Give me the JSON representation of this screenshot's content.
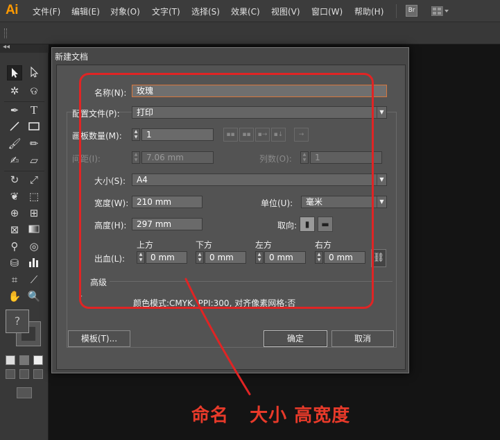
{
  "app": {
    "logo": "Ai"
  },
  "menu": [
    "文件(F)",
    "编辑(E)",
    "对象(O)",
    "文字(T)",
    "选择(S)",
    "效果(C)",
    "视图(V)",
    "窗口(W)",
    "帮助(H)"
  ],
  "menubar_extras": {
    "bridge_label": "Br"
  },
  "toolbar": {
    "tools": [
      "selection-tool",
      "direct-selection-tool",
      "magic-wand-tool",
      "lasso-tool",
      "pen-tool",
      "type-tool",
      "line-segment-tool",
      "rectangle-tool",
      "paintbrush-tool",
      "pencil-tool",
      "blob-brush-tool",
      "eraser-tool",
      "rotate-tool",
      "scale-tool",
      "warp-tool",
      "free-transform-tool",
      "shape-builder-tool",
      "perspective-grid-tool",
      "mesh-tool",
      "gradient-tool",
      "eyedropper-tool",
      "blend-tool",
      "symbol-sprayer-tool",
      "column-graph-tool",
      "artboard-tool",
      "slice-tool",
      "hand-tool",
      "zoom-tool"
    ],
    "fill_unknown_glyph": "?"
  },
  "dialog": {
    "title": "新建文档",
    "name_label": "名称(N):",
    "name_value": "玫瑰",
    "profile_label": "配置文件(P):",
    "profile_value": "打印",
    "artboards_label": "画板数量(M):",
    "artboards_value": "1",
    "spacing_label": "间距(I):",
    "spacing_value": "7.06 mm",
    "columns_label": "列数(O):",
    "columns_value": "1",
    "size_label": "大小(S):",
    "size_value": "A4",
    "width_label": "宽度(W):",
    "width_value": "210 mm",
    "units_label": "单位(U):",
    "units_value": "毫米",
    "height_label": "高度(H):",
    "height_value": "297 mm",
    "orientation_label": "取向:",
    "bleed_label": "出血(L):",
    "bleed_top_label": "上方",
    "bleed_top_value": "0 mm",
    "bleed_bottom_label": "下方",
    "bleed_bottom_value": "0 mm",
    "bleed_left_label": "左方",
    "bleed_left_value": "0 mm",
    "bleed_right_label": "右方",
    "bleed_right_value": "0 mm",
    "advanced_label": "高级",
    "summary": "颜色模式:CMYK, PPI:300, 对齐像素网格:否",
    "templates_button": "模板(T)...",
    "ok_button": "确定",
    "cancel_button": "取消"
  },
  "annotation": {
    "caption": "命名   大小 高宽度",
    "color": "#e02424"
  }
}
